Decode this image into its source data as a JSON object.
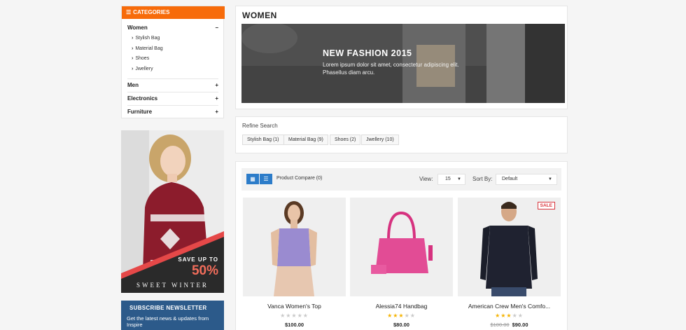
{
  "sidebar": {
    "categories_title": "CATEGORIES",
    "items": [
      {
        "label": "Women",
        "sign": "−",
        "subitems": [
          "Stylish Bag",
          "Material Bag",
          "Shoes",
          "Jwellery"
        ]
      },
      {
        "label": "Men",
        "sign": "+"
      },
      {
        "label": "Electronics",
        "sign": "+"
      },
      {
        "label": "Furniture",
        "sign": "+"
      }
    ],
    "promo": {
      "line1": "SAVE UP TO",
      "line2": "50%",
      "line3": "SWEET WINTER"
    },
    "newsletter": {
      "title": "SUBSCRIBE NEWSLETTER",
      "text": "Get the latest news & updates from Inspire"
    }
  },
  "main": {
    "page_title": "WOMEN",
    "banner": {
      "title": "NEW FASHION 2015",
      "text_line1": "Lorem ipsum dolor sit amet, consectetur adipiscing elit.",
      "text_line2": "Phasellus diam arcu."
    },
    "refine": {
      "label": "Refine Search",
      "chips": [
        "Stylish Bag (1)",
        "Material Bag (9)",
        "Shoes (2)",
        "Jwellery (10)"
      ]
    },
    "toolbar": {
      "compare": "Product Compare (0)",
      "view_label": "View:",
      "view_value": "15",
      "sort_label": "Sort By:",
      "sort_value": "Default"
    },
    "products": [
      {
        "name": "Vanca Women's Top",
        "rating": 0,
        "price": "$100.00",
        "old_price": "",
        "badge": ""
      },
      {
        "name": "Alessia74 Handbag",
        "rating": 3,
        "price": "$80.00",
        "old_price": "",
        "badge": ""
      },
      {
        "name": "American Crew Men's Comfo...",
        "rating": 3,
        "price": "$90.00",
        "old_price": "$100.00",
        "badge": "SALE"
      }
    ]
  },
  "colors": {
    "accent": "#f76b0a",
    "blue": "#2c7cc9",
    "star": "#f5b301",
    "sale": "#d9363e"
  }
}
